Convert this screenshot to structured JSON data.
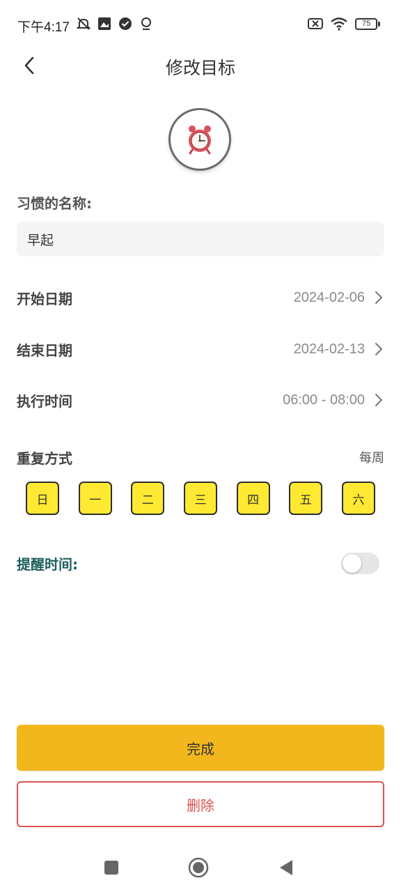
{
  "status_bar": {
    "time": "下午4:17",
    "battery_level": "75",
    "icons": [
      "mute-icon",
      "image-icon",
      "check-circle-icon",
      "location-icon",
      "sim-off-icon",
      "wifi-icon",
      "battery-icon"
    ]
  },
  "header": {
    "title": "修改目标",
    "back_icon": "chevron-left-icon"
  },
  "habit": {
    "icon": "alarm-clock-icon",
    "name_label": "习惯的名称:",
    "name_value": "早起"
  },
  "fields": {
    "start_date": {
      "label": "开始日期",
      "value": "2024-02-06"
    },
    "end_date": {
      "label": "结束日期",
      "value": "2024-02-13"
    },
    "exec_time": {
      "label": "执行时间",
      "value": "06:00 - 08:00"
    }
  },
  "repeat": {
    "label": "重复方式",
    "value": "每周",
    "days": [
      "日",
      "一",
      "二",
      "三",
      "四",
      "五",
      "六"
    ]
  },
  "reminder": {
    "label": "提醒时间:",
    "enabled": false
  },
  "actions": {
    "done": "完成",
    "delete": "删除"
  },
  "colors": {
    "accent": "#f3b71e",
    "day_fill": "#ffe933",
    "danger": "#d9534f",
    "reminder_label": "#1f5e5c"
  }
}
